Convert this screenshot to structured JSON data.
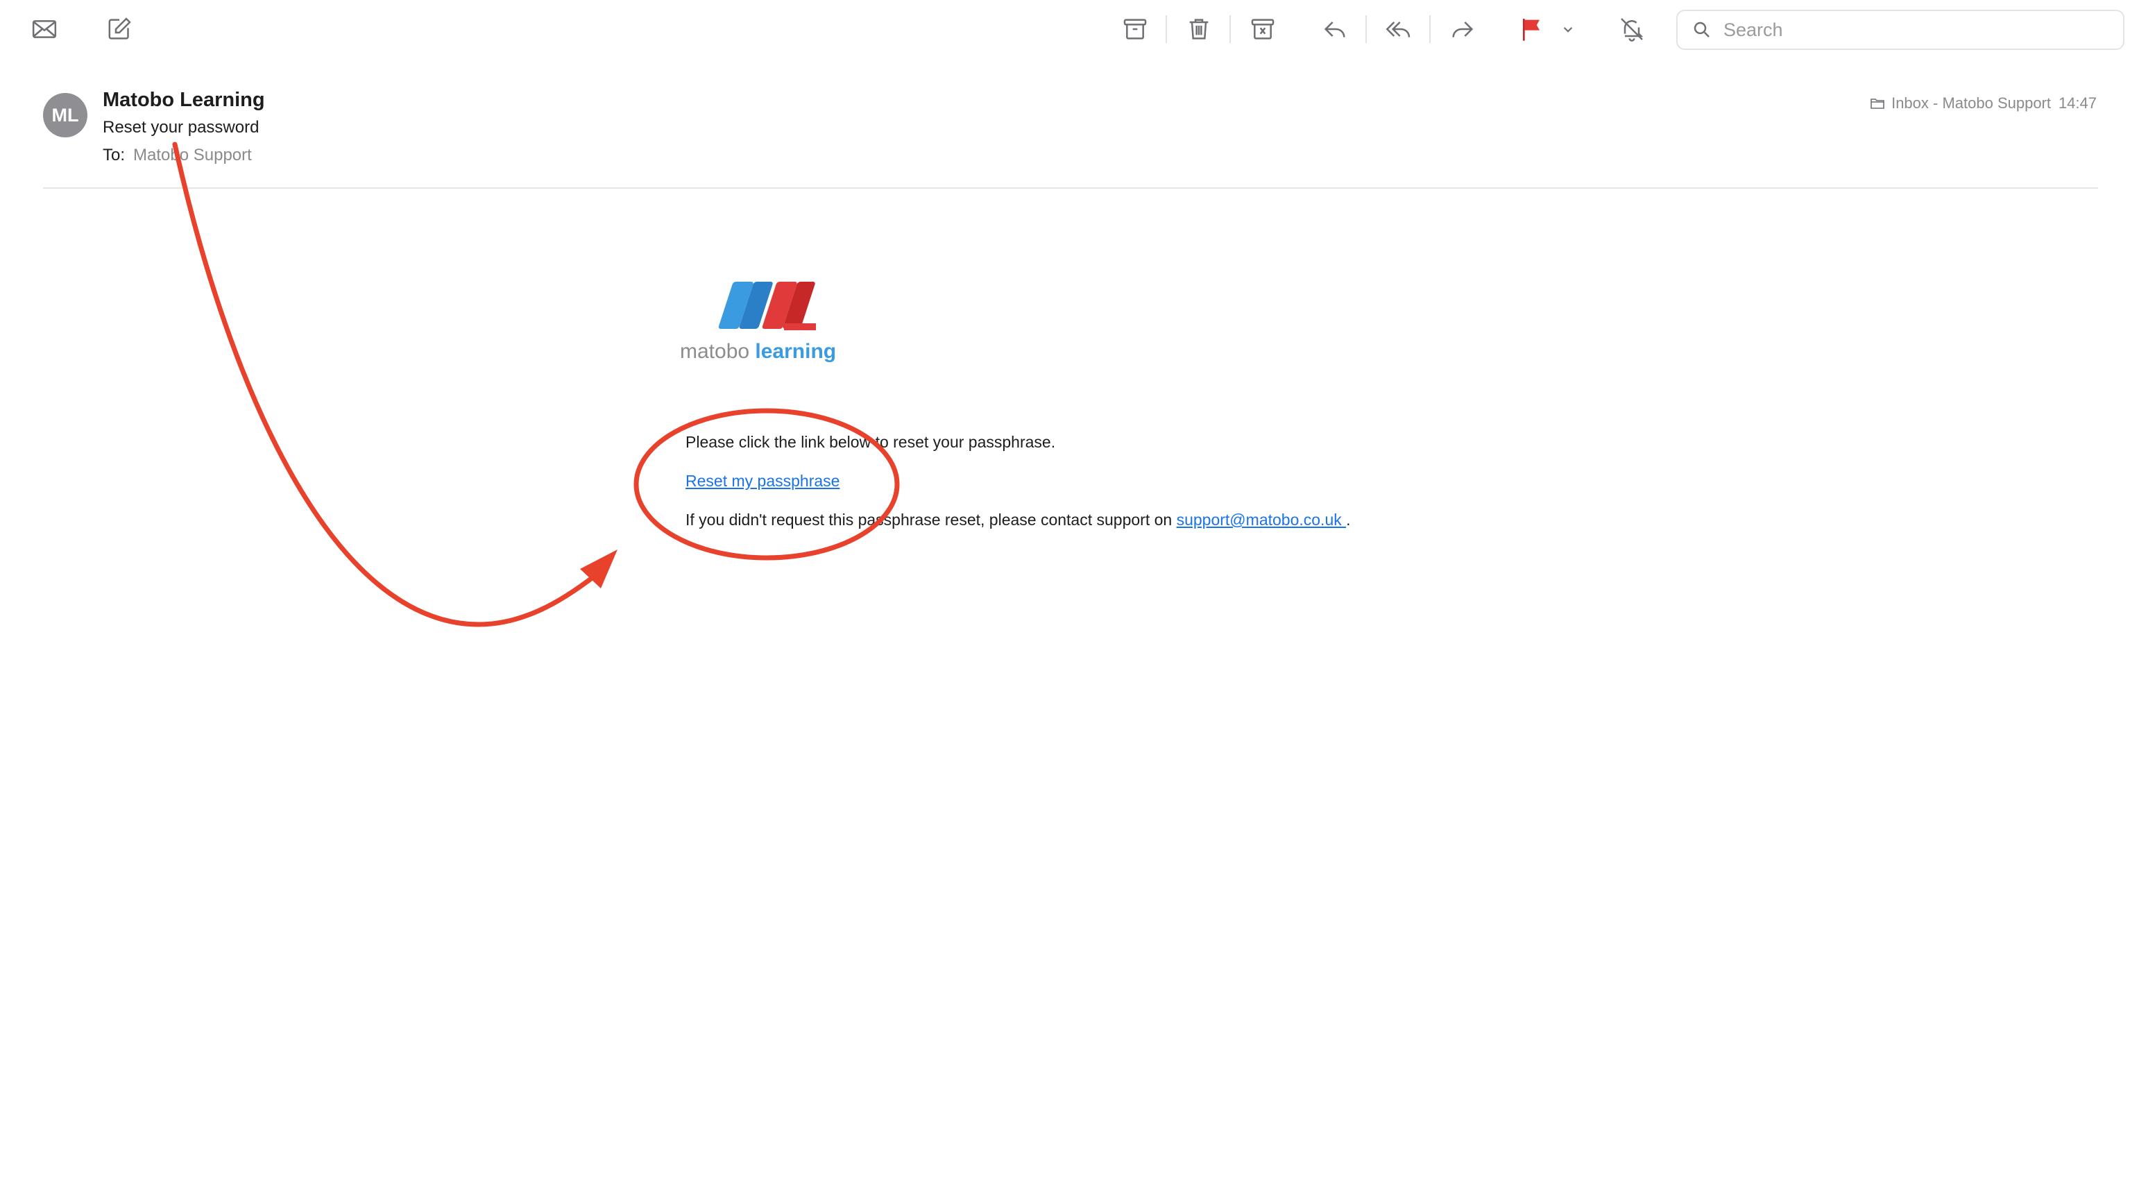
{
  "toolbar": {
    "search_placeholder": "Search",
    "flag_color": "#e53935",
    "icons": [
      "mail-icon",
      "compose-icon",
      "archive-icon",
      "trash-icon",
      "junk-icon",
      "reply-icon",
      "reply-all-icon",
      "forward-icon",
      "flag-icon",
      "chevron-down-icon",
      "mute-bell-icon",
      "search-icon"
    ]
  },
  "message": {
    "avatar_initials": "ML",
    "sender": "Matobo Learning",
    "subject": "Reset your password",
    "to_label": "To:",
    "to_value": "Matobo Support",
    "mailbox": "Inbox - Matobo Support",
    "time": "14:47"
  },
  "email_body": {
    "logo": {
      "text_light": "matobo ",
      "text_strong": "learning",
      "colors": {
        "blue": "#3a9be0",
        "red": "#e03a3a"
      }
    },
    "line1": "Please click the link below to reset your passphrase.",
    "link_text": "Reset my passphrase ",
    "line3_prefix": "If you didn't request this passphrase reset, please contact support on ",
    "support_email": "support@matobo.co.uk ",
    "line3_suffix": "."
  },
  "annotation": {
    "color": "#e8412c"
  }
}
